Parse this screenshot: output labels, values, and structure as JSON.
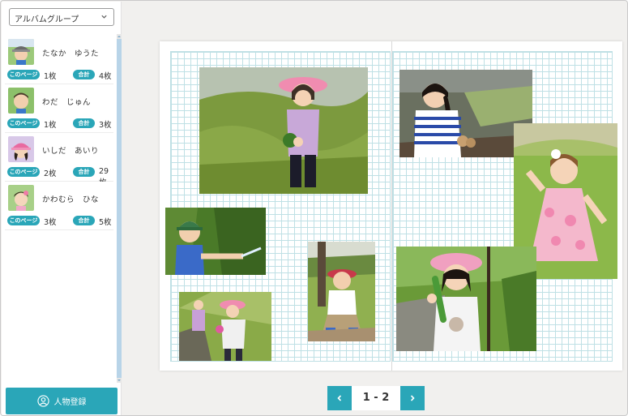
{
  "sidebar": {
    "group_select": {
      "value": "アルバムグループ",
      "icon": "chevron-down-icon"
    },
    "persons": [
      {
        "name": "たなか　ゆうた",
        "page_badge": "このページ",
        "page_count": "1枚",
        "total_badge": "合計",
        "total_count": "4枚"
      },
      {
        "name": "わだ　じゅん",
        "page_badge": "このページ",
        "page_count": "1枚",
        "total_badge": "合計",
        "total_count": "3枚"
      },
      {
        "name": "いしだ　あいり",
        "page_badge": "このページ",
        "page_count": "2枚",
        "total_badge": "合計",
        "total_count": "29枚"
      },
      {
        "name": "かわむら　ひな",
        "page_badge": "このページ",
        "page_count": "3枚",
        "total_badge": "合計",
        "total_count": "5枚"
      }
    ],
    "register_button": {
      "label": "人物登録",
      "icon": "user-circle-icon"
    }
  },
  "pager": {
    "label": "1 - 2",
    "prev_icon": "chevron-left-icon",
    "next_icon": "chevron-right-icon"
  },
  "colors": {
    "accent": "#2aa6b8",
    "grid": "#bfe0e5",
    "background": "#f1f0ee"
  }
}
